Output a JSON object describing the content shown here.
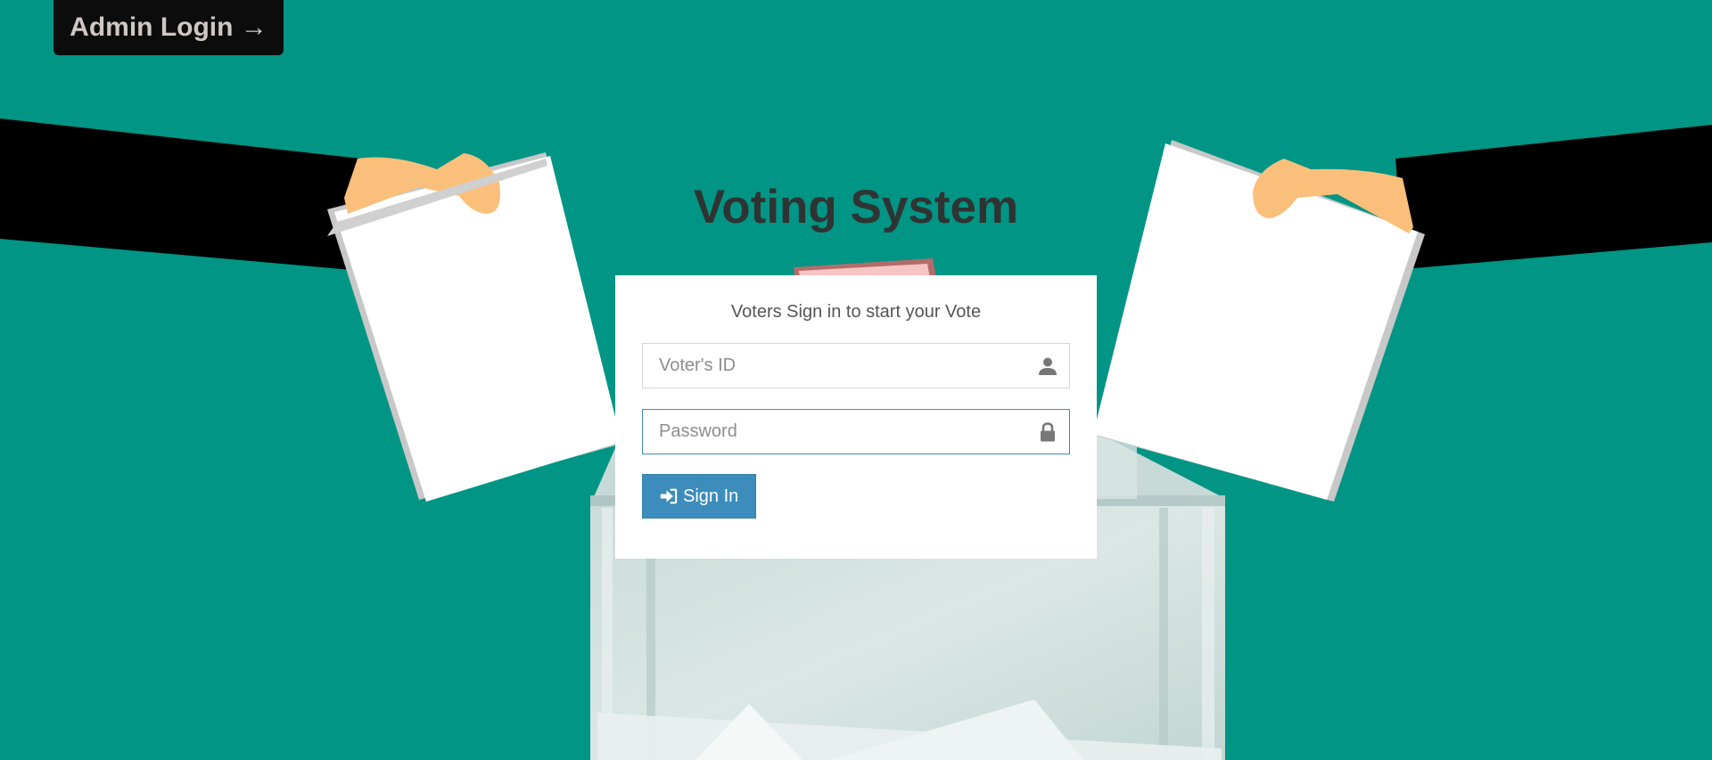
{
  "admin_login": {
    "label": "Admin Login",
    "arrow": "→"
  },
  "title": "Voting System",
  "login": {
    "message": "Voters Sign in to start your Vote",
    "voter_id_placeholder": "Voter's ID",
    "voter_id_value": "",
    "password_placeholder": "Password",
    "password_value": "",
    "signin_label": "Sign In"
  },
  "icons": {
    "voter_id": "user-icon",
    "password": "lock-icon",
    "signin": "sign-in-icon"
  },
  "colors": {
    "background": "#009585",
    "title": "#2f3433",
    "primary_button": "#3c8dbc",
    "admin_button_bg": "#0c0c0c",
    "admin_button_text": "#cfc7c4"
  }
}
